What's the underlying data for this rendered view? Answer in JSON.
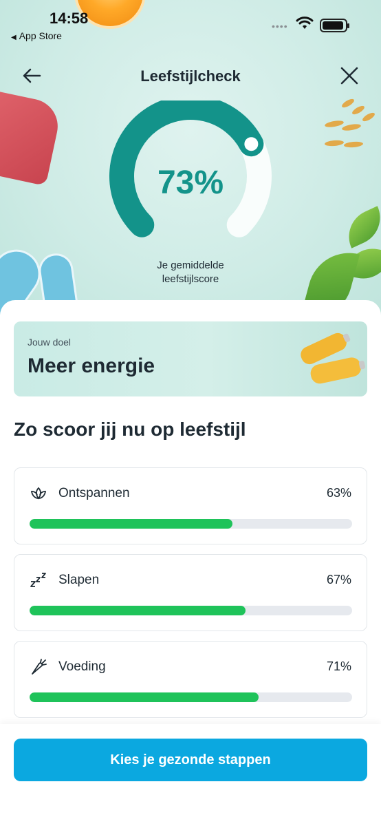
{
  "status_bar": {
    "time": "14:58",
    "back_app": "App Store"
  },
  "nav": {
    "title": "Leefstijlcheck"
  },
  "score": {
    "value": "73%",
    "fraction": 0.73,
    "caption_line1": "Je gemiddelde",
    "caption_line2": "leefstijlscore"
  },
  "goal": {
    "label": "Jouw doel",
    "value": "Meer energie"
  },
  "section": {
    "title": "Zo scoor jij nu op leefstijl"
  },
  "categories": [
    {
      "icon": "lotus-icon",
      "label": "Ontspannen",
      "percent": "63%",
      "fraction": 0.63
    },
    {
      "icon": "sleep-zzz-icon",
      "label": "Slapen",
      "percent": "67%",
      "fraction": 0.67
    },
    {
      "icon": "carrot-icon",
      "label": "Voeding",
      "percent": "71%",
      "fraction": 0.71
    }
  ],
  "cta": {
    "label": "Kies je gezonde stappen"
  },
  "colors": {
    "gauge": "#13938a",
    "progress": "#1fc35a",
    "cta": "#0ba8e0"
  }
}
